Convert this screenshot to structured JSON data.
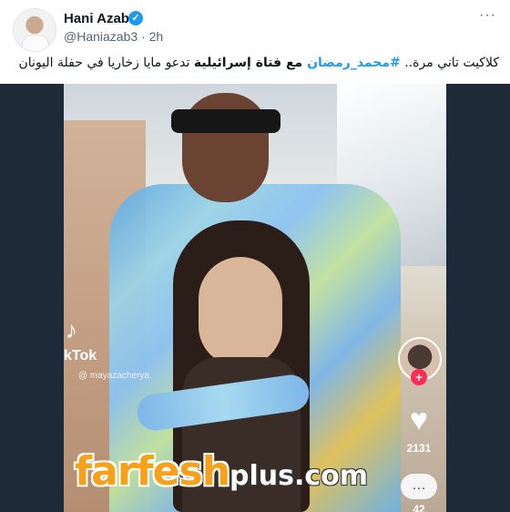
{
  "tweet": {
    "author_name": "Hani Azab",
    "handle": "@Haniazab3",
    "separator": "·",
    "time": "2h",
    "more_icon": "more-horizontal-icon",
    "verified_icon": "verified-badge-icon",
    "text_parts": {
      "part1": "كلاكيت تاني مرة.. ",
      "hashtag": "#محمد_رمضان",
      "part2": " مع فتاة إسرائيلية",
      "part3": " تدعو مايا زخاريا في حفلة اليونان"
    },
    "colors": {
      "link": "#1d9bf0",
      "text": "#0f1419",
      "muted": "#536471"
    }
  },
  "media": {
    "tiktok": {
      "logo": "♪",
      "label": "kTok",
      "handle": "@ mayazacherya"
    },
    "rail": {
      "plus": "+",
      "heart": "♥",
      "likes": "2131",
      "comment_icon": "…",
      "comments": "42"
    },
    "watermark": {
      "main": "farfesh",
      "suffix": "plus.com"
    },
    "colors": {
      "watermark": "#f7a11a",
      "tiktok_red": "#fe2c55",
      "backdrop": "#1e2a37"
    }
  }
}
